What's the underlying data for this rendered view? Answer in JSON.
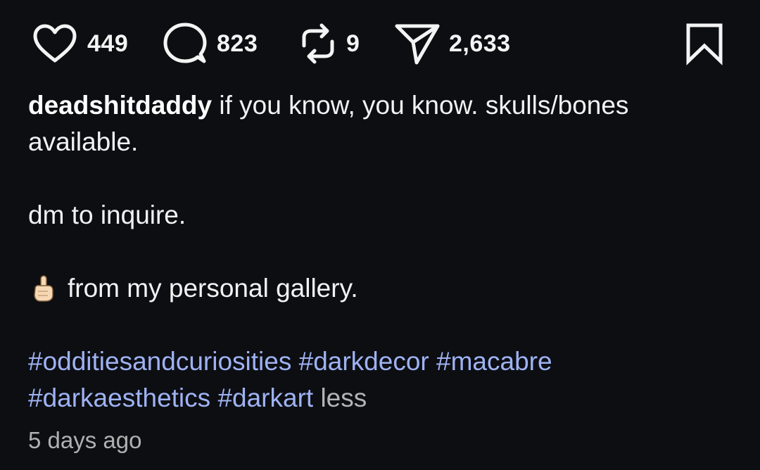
{
  "actions": {
    "like": {
      "icon": "heart-icon",
      "count": "449"
    },
    "comment": {
      "icon": "comment-bubble-icon",
      "count": "823"
    },
    "repost": {
      "icon": "repost-icon",
      "count": "9"
    },
    "share": {
      "icon": "send-paper-plane-icon",
      "count": "2,633"
    },
    "save": {
      "icon": "bookmark-icon"
    }
  },
  "post": {
    "username": "deadshitdaddy",
    "caption_line_1": "if you know, you know. skulls/bones available.",
    "caption_line_2": "dm to inquire.",
    "caption_line_3_emoji": "index-pointing-up-emoji",
    "caption_line_3": "from my personal gallery.",
    "hashtags": [
      "#odditiesandcuriosities",
      "#darkdecor",
      "#macabre",
      "#darkaesthetics",
      "#darkart"
    ],
    "less_label": "less",
    "timestamp": "5 days ago"
  },
  "colors": {
    "background": "#0c0e12",
    "text": "#f2f2f2",
    "hashtag": "#9fb2f3",
    "muted": "#b0b0b0"
  }
}
